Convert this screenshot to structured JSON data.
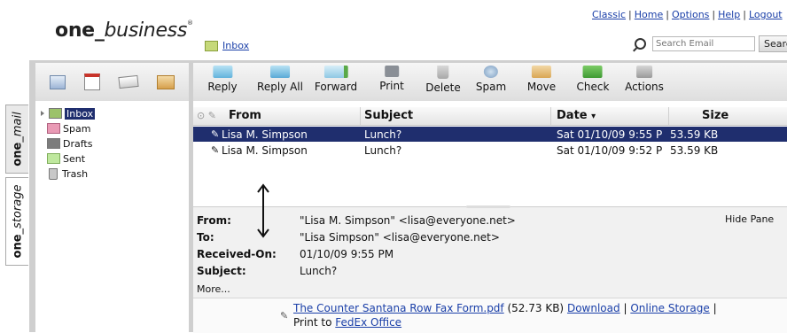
{
  "brand": {
    "one": "one",
    "underscore": "_",
    "business": "business",
    "mark": "®"
  },
  "top_links": [
    "Classic",
    "Home",
    "Options",
    "Help",
    "Logout"
  ],
  "breadcrumb": {
    "folder": "Inbox"
  },
  "search": {
    "placeholder": "Search Email",
    "button": "Search"
  },
  "left_toolbar": {
    "icons": [
      "contacts-icon",
      "calendar-icon",
      "notes-icon",
      "folder-icon"
    ]
  },
  "toolbar": {
    "buttons": [
      "Reply",
      "Reply All",
      "Forward",
      "Print",
      "Delete",
      "Spam",
      "Move",
      "Check",
      "Actions"
    ],
    "move_has_dropdown": true,
    "check_has_dropdown": true,
    "actions_has_dropdown": true
  },
  "side_tabs": {
    "mail": {
      "one": "one",
      "suffix": "_mail"
    },
    "storage": {
      "one": "one",
      "suffix": "_storage"
    }
  },
  "folders": [
    {
      "name": "Inbox",
      "selected": true
    },
    {
      "name": "Spam"
    },
    {
      "name": "Drafts"
    },
    {
      "name": "Sent"
    },
    {
      "name": "Trash"
    }
  ],
  "list": {
    "columns": {
      "from": "From",
      "subject": "Subject",
      "date": "Date",
      "date_sort": "▾",
      "size": "Size"
    },
    "rows": [
      {
        "from": "Lisa M. Simpson",
        "subject": "Lunch?",
        "date": "Sat 01/10/09 9:55 P",
        "size": "53.59 KB",
        "selected": true
      },
      {
        "from": "Lisa M. Simpson",
        "subject": "Lunch?",
        "date": "Sat 01/10/09 9:52 P",
        "size": "53.59 KB",
        "selected": false
      }
    ]
  },
  "message": {
    "labels": {
      "from": "From:",
      "to": "To:",
      "received": "Received-On:",
      "subject": "Subject:"
    },
    "from": "\"Lisa M. Simpson\" <lisa@everyone.net>",
    "to": "\"Lisa Simpson\" <lisa@everyone.net>",
    "received": "01/10/09 9:55 PM",
    "subject": "Lunch?",
    "more": "More...",
    "hide_pane": "Hide Pane"
  },
  "attachment": {
    "file": "The Counter Santana Row Fax Form.pdf",
    "size": "(52.73 KB)",
    "download": "Download",
    "online_storage": "Online Storage",
    "sep": "|",
    "print_to": "Print to",
    "fedex": "FedEx Office"
  },
  "colors": {
    "selection": "#1f2e6e",
    "link": "#1a3fa8",
    "frame": "#cfcfcf"
  }
}
